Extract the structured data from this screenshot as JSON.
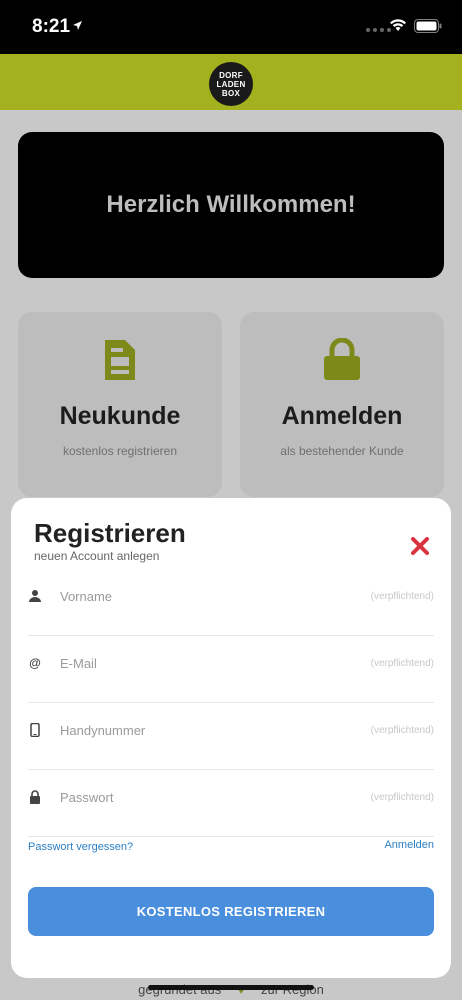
{
  "status_bar": {
    "time": "8:21"
  },
  "header": {
    "logo_lines": [
      "DORF",
      "LADEN",
      "BOX"
    ]
  },
  "welcome": {
    "title": "Herzlich Willkommen!"
  },
  "tiles": [
    {
      "title": "Neukunde",
      "subtitle": "kostenlos registrieren",
      "icon": "document-icon"
    },
    {
      "title": "Anmelden",
      "subtitle": "als bestehender Kunde",
      "icon": "lock-icon"
    }
  ],
  "footer": {
    "left": "gegründet aus",
    "right": "zur Region"
  },
  "modal": {
    "title": "Registrieren",
    "subtitle": "neuen Account anlegen",
    "fields": [
      {
        "placeholder": "Vorname",
        "hint": "(verpflichtend)",
        "icon": "user-icon"
      },
      {
        "placeholder": "E-Mail",
        "hint": "(verpflichtend)",
        "icon": "at-icon"
      },
      {
        "placeholder": "Handynummer",
        "hint": "(verpflichtend)",
        "icon": "phone-icon"
      },
      {
        "placeholder": "Passwort",
        "hint": "(verpflichtend)",
        "icon": "lock-icon"
      }
    ],
    "forgot_password": "Passwort vergessen?",
    "login_link": "Anmelden",
    "submit": "KOSTENLOS REGISTRIEREN"
  },
  "colors": {
    "brand_green": "#a3b11e",
    "primary_button": "#4a8fdd",
    "link": "#2b7fc4",
    "close_red": "#d9333f"
  }
}
